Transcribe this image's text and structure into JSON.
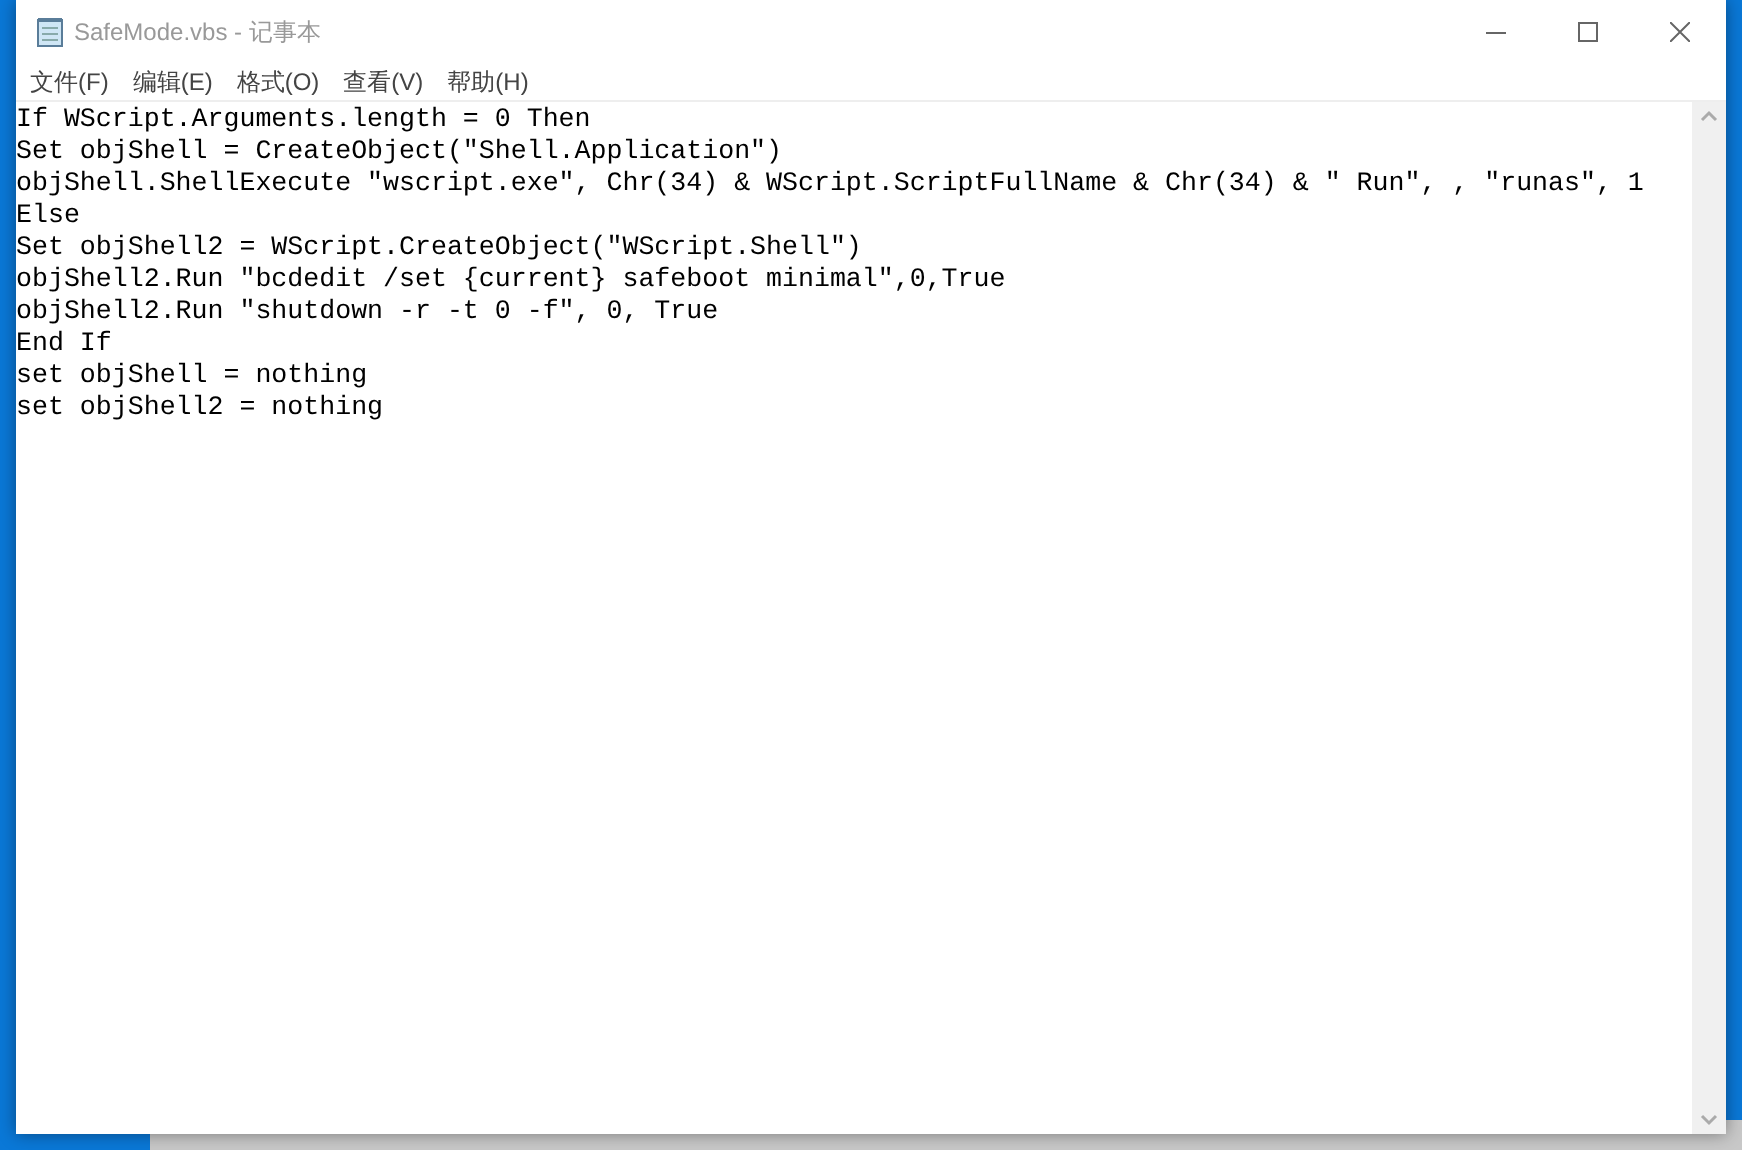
{
  "window": {
    "title": "SafeMode.vbs - 记事本"
  },
  "menu": [
    "文件(F)",
    "编辑(E)",
    "格式(O)",
    "查看(V)",
    "帮助(H)"
  ],
  "editor": {
    "lines": [
      "If WScript.Arguments.length = 0 Then",
      "Set objShell = CreateObject(\"Shell.Application\")",
      "objShell.ShellExecute \"wscript.exe\", Chr(34) & WScript.ScriptFullName & Chr(34) & \" Run\", , \"runas\", 1",
      "Else",
      "Set objShell2 = WScript.CreateObject(\"WScript.Shell\")",
      "objShell2.Run \"bcdedit /set {current} safeboot minimal\",0,True",
      "objShell2.Run \"shutdown -r -t 0 -f\", 0, True",
      "End If",
      "set objShell = nothing",
      "set objShell2 = nothing"
    ]
  }
}
